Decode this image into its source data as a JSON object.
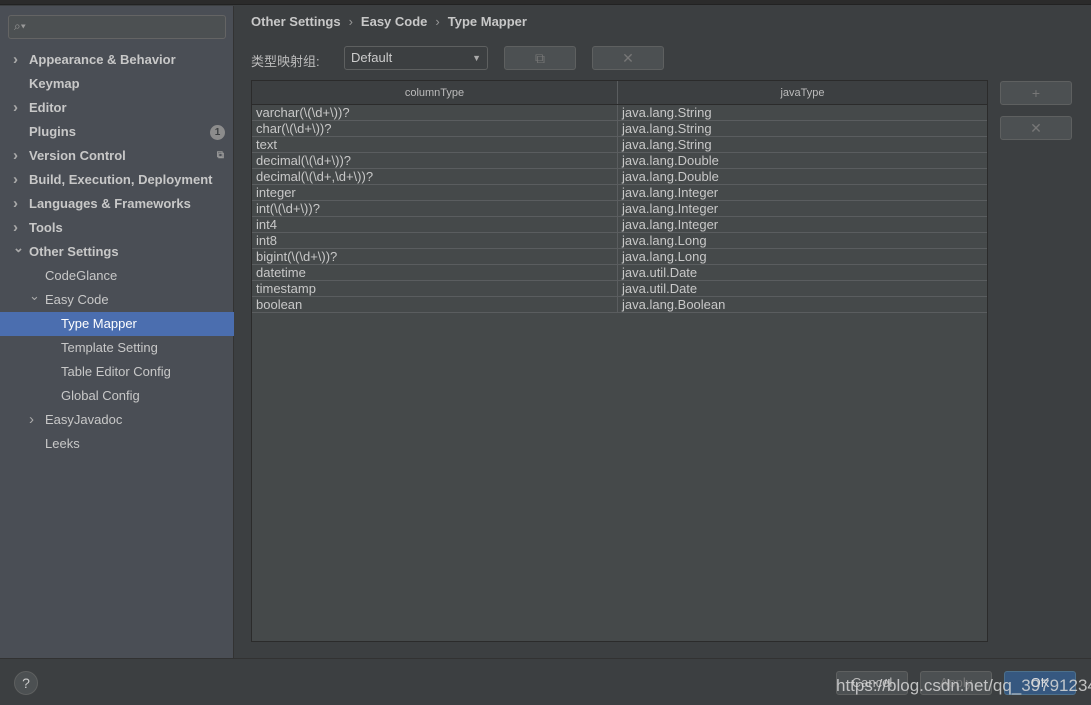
{
  "search": {
    "placeholder": "",
    "icon": "search-icon"
  },
  "sidebar": {
    "items": [
      {
        "label": "Appearance & Behavior",
        "bold": true,
        "arrow": "right",
        "indent": 0
      },
      {
        "label": "Keymap",
        "bold": true,
        "indent": 0
      },
      {
        "label": "Editor",
        "bold": true,
        "arrow": "right",
        "indent": 0
      },
      {
        "label": "Plugins",
        "bold": true,
        "indent": 0,
        "badge": "1"
      },
      {
        "label": "Version Control",
        "bold": true,
        "arrow": "right",
        "indent": 0,
        "icon": "copy-icon"
      },
      {
        "label": "Build, Execution, Deployment",
        "bold": true,
        "arrow": "right",
        "indent": 0
      },
      {
        "label": "Languages & Frameworks",
        "bold": true,
        "arrow": "right",
        "indent": 0
      },
      {
        "label": "Tools",
        "bold": true,
        "arrow": "right",
        "indent": 0
      },
      {
        "label": "Other Settings",
        "bold": true,
        "arrow": "down",
        "indent": 0
      },
      {
        "label": "CodeGlance",
        "indent": 1
      },
      {
        "label": "Easy Code",
        "arrow": "down",
        "indent": 1
      },
      {
        "label": "Type Mapper",
        "indent": 2,
        "selected": true
      },
      {
        "label": "Template Setting",
        "indent": 2
      },
      {
        "label": "Table Editor Config",
        "indent": 2
      },
      {
        "label": "Global Config",
        "indent": 2
      },
      {
        "label": "EasyJavadoc",
        "arrow": "right",
        "indent": 1
      },
      {
        "label": "Leeks",
        "indent": 1
      }
    ]
  },
  "breadcrumb": [
    "Other Settings",
    "Easy Code",
    "Type Mapper"
  ],
  "group": {
    "label": "类型映射组:",
    "value": "Default"
  },
  "table": {
    "headers": [
      "columnType",
      "javaType"
    ],
    "rows": [
      [
        "varchar(\\(\\d+\\))?",
        "java.lang.String"
      ],
      [
        "char(\\(\\d+\\))?",
        "java.lang.String"
      ],
      [
        "text",
        "java.lang.String"
      ],
      [
        "decimal(\\(\\d+\\))?",
        "java.lang.Double"
      ],
      [
        "decimal(\\(\\d+,\\d+\\))?",
        "java.lang.Double"
      ],
      [
        "integer",
        "java.lang.Integer"
      ],
      [
        "int(\\(\\d+\\))?",
        "java.lang.Integer"
      ],
      [
        "int4",
        "java.lang.Integer"
      ],
      [
        "int8",
        "java.lang.Long"
      ],
      [
        "bigint(\\(\\d+\\))?",
        "java.lang.Long"
      ],
      [
        "datetime",
        "java.util.Date"
      ],
      [
        "timestamp",
        "java.util.Date"
      ],
      [
        "boolean",
        "java.lang.Boolean"
      ]
    ]
  },
  "buttons": {
    "copy": "⧉",
    "delete_group": "✕",
    "add": "+",
    "remove": "✕",
    "help": "?",
    "cancel": "Cancel",
    "apply": "Apply",
    "ok": "OK"
  },
  "watermark": "https://blog.csdn.net/qq_39791234",
  "colors": {
    "selection": "#4b6eaf",
    "sidebar": "#4a4e55",
    "background": "#3c3f41"
  }
}
